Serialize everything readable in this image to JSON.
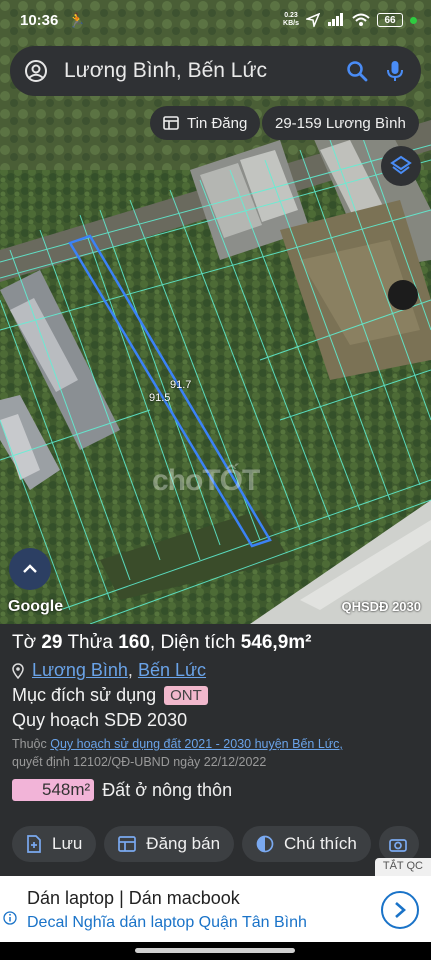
{
  "status": {
    "time": "10:36",
    "runner_icon": "walk-icon",
    "net_speed_value": "0.23",
    "net_speed_unit": "KB/s",
    "battery": "66"
  },
  "search": {
    "query": "Lương Bình, Bến Lức"
  },
  "chips": {
    "listing": "Tin Đăng",
    "address": "29-159 Lương Bình"
  },
  "map": {
    "google_label": "Google",
    "layer_label": "QHSDĐ 2030",
    "watermark": "choTỐT",
    "dimension_a": "91.7",
    "dimension_b": "91.5"
  },
  "parcel": {
    "sheet_label": "Tờ",
    "sheet_no": "29",
    "lot_label": "Thửa",
    "lot_no": "160",
    "area_label": "Diện tích",
    "area_value": "546,9m²",
    "commune": "Lương Bình",
    "district": "Bến Lức",
    "purpose_label": "Mục đích sử dụng",
    "purpose_code": "ONT",
    "plan_title": "Quy hoạch SDĐ 2030",
    "note_prefix": "Thuộc",
    "note_link": "Quy hoạch sử dụng đất 2021 - 2030 huyện Bến Lức,",
    "note_line2": "quyết định 12102/QĐ-UBND ngày 22/12/2022",
    "plan_area": "548m²",
    "plan_area_type": "Đất ở nông thôn"
  },
  "actions": {
    "save": "Lưu",
    "post_sale": "Đăng bán",
    "legend": "Chú thích"
  },
  "ad": {
    "close_label": "TẮT QC",
    "title": "Dán laptop | Dán macbook",
    "subtitle": "Decal Nghĩa dán laptop Quận Tân Bình"
  },
  "colors": {
    "panel_bg": "#2c2e30",
    "link": "#6aa3e8",
    "purpose_badge": "#f1b8cc",
    "area_badge": "#f2b4d8",
    "parcel_outline": "#3b82f6",
    "ad_link": "#1a73c8"
  }
}
